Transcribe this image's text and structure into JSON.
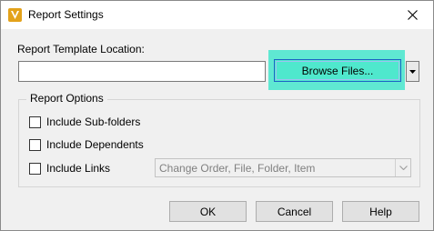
{
  "window": {
    "title": "Report Settings",
    "app_icon": "vault-logo-icon",
    "close_icon": "close-icon"
  },
  "template_location": {
    "label": "Report Template Location:",
    "path_value": "",
    "browse_label": "Browse Files...",
    "dropdown_icon": "triangle-down-icon"
  },
  "report_options": {
    "title": "Report Options",
    "include_subfolders": {
      "label": "Include Sub-folders",
      "checked": false
    },
    "include_dependents": {
      "label": "Include Dependents",
      "checked": false
    },
    "include_links": {
      "label": "Include Links",
      "checked": false
    },
    "links_order": {
      "selected": "Change Order, File, Folder, Item",
      "enabled": false
    }
  },
  "buttons": {
    "ok": "OK",
    "cancel": "Cancel",
    "help": "Help"
  },
  "colors": {
    "highlight": "#5fe8d2",
    "browse_button": "#4fe8cd",
    "app_icon": "#e3a21a"
  }
}
